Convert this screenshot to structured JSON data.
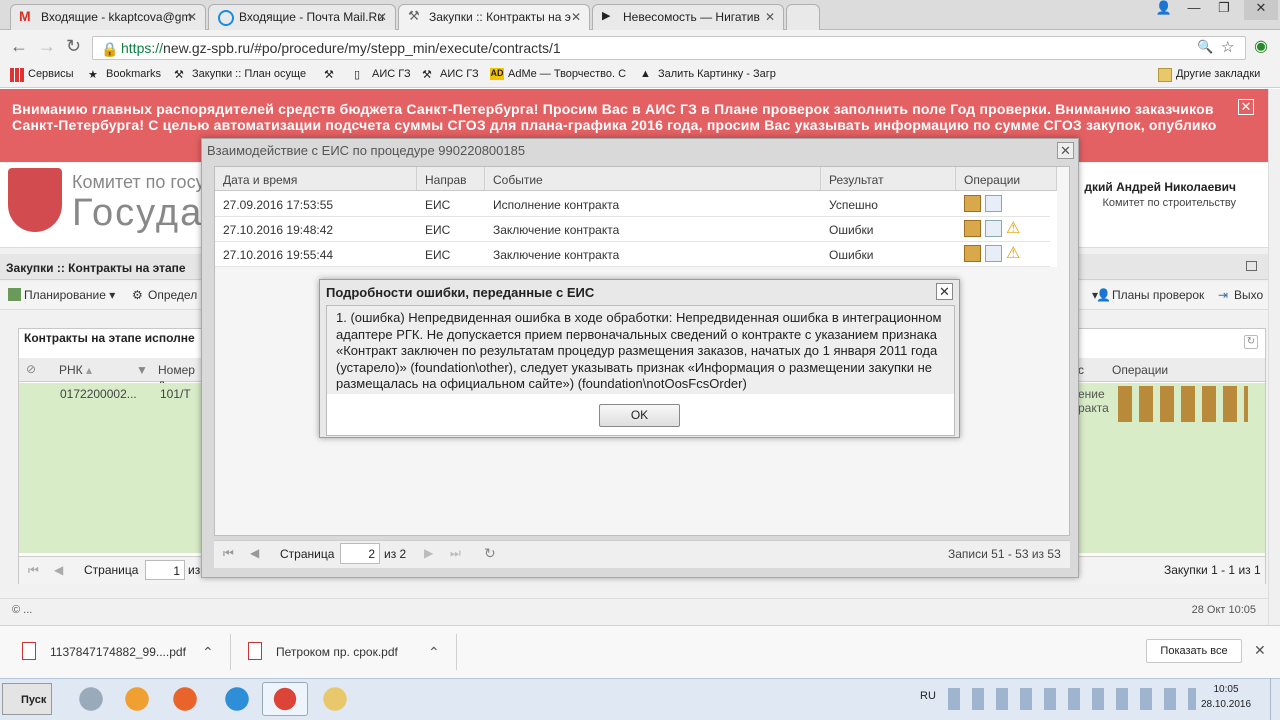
{
  "browser": {
    "tabs": [
      {
        "label": "Входящие - kkaptcova@gm",
        "icon_color": "#d93025"
      },
      {
        "label": "Входящие - Почта Mail.Ru",
        "icon_color": "#168de2"
      },
      {
        "label": "Закупки :: Контракты на э",
        "icon_color": "#888888"
      },
      {
        "label": "Невесомость — Нигатив",
        "icon_color": "#222222"
      }
    ],
    "url_proto": "https://",
    "url_rest": "new.gz-spb.ru/#po/procedure/my/stepp_min/execute/contracts/1",
    "bookmarks": [
      "Сервисы",
      "Bookmarks",
      "Закупки :: План осуще",
      "АИС ГЗ",
      "АИС ГЗ",
      "AdMe — Творчество. С",
      "Залить Картинку - Загр",
      "Другие закладки"
    ]
  },
  "page": {
    "banner": "Вниманию главных распорядителей средств бюджета Санкт-Петербурга! Просим Вас в АИС ГЗ в Плане проверок заполнить поле Год проверки. Вниманию заказчиков Санкт-Петербурга! С целью автоматизации подсчета суммы СГОЗ для плана-графика 2016 года, просим Вас указывать информацию по сумме СГОЗ закупок, опублико",
    "logo_line1": "Комитет по госуда",
    "logo_line2": "Госуда",
    "user_name": "дкий Андрей Николаевич",
    "user_org": "Комитет по строительству",
    "section_title": "Закупки :: Контракты на этапе",
    "menu": {
      "planning": "Планирование",
      "define": "Определ",
      "plans": "Планы проверок",
      "exit": "Выхо"
    },
    "panel_title": "Контракты на этапе исполне",
    "panel_cols": {
      "rnk": "РНК",
      "number": "Номер д",
      "operations": "Операции",
      "c": "с"
    },
    "panel_row": {
      "rnk": "0172200002...",
      "number": "101/Т",
      "side1": "ение",
      "side2": "ракта"
    },
    "panel_footer": {
      "page_label": "Страница",
      "page_value": "1",
      "of": "из",
      "records": "Закупки 1 - 1 из 1"
    },
    "status_left": "© ...",
    "status_right": "28 Окт 10:05"
  },
  "eis_dialog": {
    "title": "Взаимодействие с ЕИС по процедуре 990220800185",
    "columns": [
      "Дата и время",
      "Направ",
      "Событие",
      "Результат",
      "Операции"
    ],
    "rows": [
      {
        "datetime": "27.09.2016 17:53:55",
        "direction": "ЕИС",
        "event": "Исполнение контракта",
        "result": "Успешно",
        "warn": false
      },
      {
        "datetime": "27.10.2016 19:48:42",
        "direction": "ЕИС",
        "event": "Заключение контракта",
        "result": "Ошибки",
        "warn": true
      },
      {
        "datetime": "27.10.2016 19:55:44",
        "direction": "ЕИС",
        "event": "Заключение контракта",
        "result": "Ошибки",
        "warn": true
      }
    ],
    "footer": {
      "page_label": "Страница",
      "page_value": "2",
      "of": "из 2",
      "records": "Записи 51 - 53 из 53"
    }
  },
  "error_dialog": {
    "title": "Подробности ошибки, переданные с ЕИС",
    "message": "1. (ошибка) Непредвиденная ошибка в ходе обработки: Непредвиденная ошибка в интеграционном адаптере РГК. Не допускается прием первоначальных сведений о контракте с указанием признака «Контракт заключен по результатам процедур размещения заказов, начатых до 1 января 2011 года (устарело)» (foundation\\other), следует указывать признак «Информация о размещении закупки не размещалась на официальном сайте») (foundation\\notOosFcsOrder)",
    "ok_label": "OK"
  },
  "downloads": [
    {
      "name": "1137847174882_99....pdf"
    },
    {
      "name": "Петроком пр. срок.pdf"
    }
  ],
  "downloads_show_all": "Показать все",
  "taskbar": {
    "start_label": "Пуск",
    "lang": "RU",
    "time": "10:05",
    "date": "28.10.2016"
  }
}
